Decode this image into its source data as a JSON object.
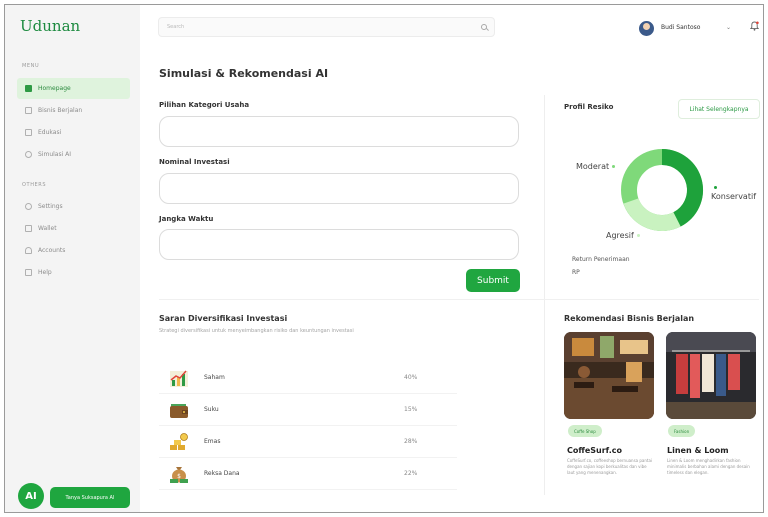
{
  "app": {
    "name": "Udunan"
  },
  "sidebar": {
    "menu_label": "MENU",
    "others_label": "OTHERS",
    "menu_items": [
      {
        "label": "Homepage",
        "icon": "home-icon",
        "active": true
      },
      {
        "label": "Bisnis Berjalan",
        "icon": "cart-icon",
        "active": false
      },
      {
        "label": "Edukasi",
        "icon": "book-icon",
        "active": false
      },
      {
        "label": "Simulasi AI",
        "icon": "ai-icon",
        "active": false
      }
    ],
    "other_items": [
      {
        "label": "Settings",
        "icon": "gear-icon"
      },
      {
        "label": "Wallet",
        "icon": "wallet-icon"
      },
      {
        "label": "Accounts",
        "icon": "user-icon"
      },
      {
        "label": "Help",
        "icon": "help-icon"
      }
    ],
    "ai_badge": "AI",
    "ask_button": "Tanya Suksapura AI"
  },
  "header": {
    "search_placeholder": "Search",
    "user_name": "Budi Santoso",
    "chevron": "⌄",
    "bell": "🔔"
  },
  "main": {
    "title": "Simulasi & Rekomendasi AI",
    "fields": [
      {
        "label": "Pilihan Kategori Usaha",
        "value": ""
      },
      {
        "label": "Nominal Investasi",
        "value": ""
      },
      {
        "label": "Jangka Waktu",
        "value": ""
      }
    ],
    "submit_label": "Submit"
  },
  "risk_profile": {
    "title": "Profil Resiko",
    "see_more": "Lihat Selengkapnya",
    "segments": [
      {
        "label": "Konservatif",
        "color": "#1ea23b"
      },
      {
        "label": "Agresif",
        "color": "#c9f2c0"
      },
      {
        "label": "Moderat",
        "color": "#7fd97a"
      }
    ],
    "return_label": "Return Penerimaan",
    "return_value": "RP"
  },
  "diversification": {
    "title": "Saran Diversifikasi Investasi",
    "subtitle": "Strategi diversifikasi untuk menyeimbangkan risiko dan keuntungan investasi",
    "assets": [
      {
        "name": "Saham",
        "percent": "40%",
        "icon": "stock-chart-icon"
      },
      {
        "name": "Suku",
        "percent": "15%",
        "icon": "wallet-icon"
      },
      {
        "name": "Emas",
        "percent": "28%",
        "icon": "gold-icon"
      },
      {
        "name": "Reksa Dana",
        "percent": "22%",
        "icon": "money-bag-icon"
      }
    ]
  },
  "recommendations": {
    "title": "Rekomendasi Bisnis Berjalan",
    "items": [
      {
        "tag": "Coffe Shop",
        "name": "CoffeSurf.co",
        "description": "CoffeSurf.co, coffeeshop bernuansa pantai dengan sajian kopi berkualitas dan vibe laut yang menenangkan."
      },
      {
        "tag": "Fashion",
        "name": "Linen & Loom",
        "description": "Linen & Loom menghadirkan fashion minimalis berbahan alami dengan desain timeless dan elegan."
      }
    ]
  }
}
